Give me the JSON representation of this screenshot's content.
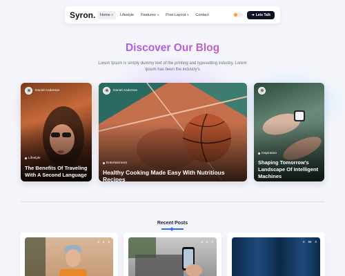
{
  "header": {
    "logo": "Syron.",
    "nav": [
      {
        "label": "Home",
        "dropdown": true,
        "active": true
      },
      {
        "label": "Lifestyle",
        "dropdown": false
      },
      {
        "label": "Features",
        "dropdown": true
      },
      {
        "label": "Post Layout",
        "dropdown": true
      },
      {
        "label": "Contact",
        "dropdown": false
      }
    ],
    "cta_label": "Lets Talk"
  },
  "hero": {
    "title": "Discover Our Blog",
    "subtitle": "Lorem Ipsum is simply dummy text of the printing and typesetting industry. Lorem Ipsum has been the industry's"
  },
  "featured": [
    {
      "author": "Daniel Anderson",
      "category": "Lifestyle",
      "title": "The Benefits Of Traveling With A Second Language"
    },
    {
      "author": "Daniel Anderson",
      "category": "Entertainment",
      "title": "Healthy Cooking Made Easy With Nutritious Recipes"
    },
    {
      "author": "Daniel Anderson",
      "category": "Inspiration",
      "title": "Shaping Tomorrow's Landscape Of Intelligent Machines"
    }
  ],
  "recent": {
    "heading": "Recent Posts",
    "posts": [
      {
        "stats": [
          "0",
          "0",
          "0"
        ]
      },
      {
        "stats": [
          "0",
          "0",
          "0"
        ]
      },
      {
        "stats": [
          "0",
          "96",
          "0"
        ]
      }
    ]
  },
  "colors": {
    "accent": "#2f6bff",
    "cta_bg": "#0f1222"
  }
}
